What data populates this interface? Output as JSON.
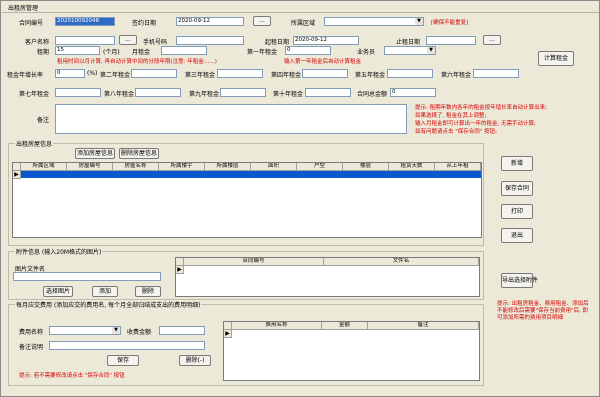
{
  "title": "出租房管理",
  "header": {
    "contract_no_label": "合同编号",
    "contract_no_value": "202010092048",
    "sign_date_label": "签约日期",
    "sign_date_value": "2020-09-12",
    "house_label": "所属区域",
    "note_dup": "[确保不能重复]",
    "tenant_label": "客户名称",
    "mobile_label": "手机号码",
    "start_label": "起租日期",
    "start_value": "2020-09-12",
    "end_label": "止租日期",
    "lease_label": "租期",
    "lease_value": "15",
    "lease_unit": "(个月)",
    "monthly_label": "月租金",
    "first_rent_label": "第一年租金",
    "first_rent_value": "0",
    "clerk_label": "业务员",
    "note_lease": "租用时间以月计算, 再自动计算中间的分段年限(注意: 年租金……)",
    "note_first": "输入第一年租金后自动计算租金",
    "calc_btn": "计算租金",
    "rent_growth_label": "租金年增长率",
    "rent_growth_value": "0",
    "pct": "(%)",
    "y2": "第二年租金",
    "y3": "第三年租金",
    "y4": "第四年租金",
    "y5": "第五年租金",
    "y6": "第六年租金",
    "y7": "第七年租金",
    "y8": "第八年租金",
    "y9": "第九年租金",
    "y10": "第十年租金",
    "total_label": "合同总金额",
    "total_value": "0",
    "remark_label": "备注",
    "tip1": "提示: 租期年数内各年的租金按年增长率自动计算出来;",
    "tip2": "    如果选择了, 租金在其上调整;",
    "tip3": "    输入月租金即可计算出一年的租金, 无需手动计算;",
    "tip4": "    如有问题请点击 \"保存合同\" 按钮。",
    "browse": "..."
  },
  "rooms": {
    "group_title": "出租房屋信息",
    "add_btn": "添加房屋信息",
    "del_btn": "删除房屋信息",
    "columns": [
      "所属区域",
      "房屋编号",
      "房屋名称",
      "所属楼宇",
      "所属楼层",
      "面积",
      "户型",
      "楼层",
      "租赁天数",
      "从上年租"
    ],
    "side_btns": [
      "新增",
      "保存合同",
      "打印",
      "退出"
    ]
  },
  "attach": {
    "group_title": "附件信息 (输入20M格式的图片)",
    "file_label": "图片文件名",
    "choose_btn": "选择图片",
    "add_btn": "添加",
    "delete_btn": "删除",
    "columns": [
      "合同编号",
      "文件名"
    ],
    "export_btn": "导出选择附件"
  },
  "fees": {
    "group_title": "每月应交费用 (添加应交的费用名, 每个月全部归结成支出的费用明细)",
    "fee_name_label": "费用名称",
    "amount_label": "收费金额",
    "fee_remark_label": "备注说明",
    "save_btn": "保存",
    "delete_btn": "删除(-)",
    "columns": [
      "费用名称",
      "金额",
      "备注"
    ],
    "tip": "提示: 若不需要修改请点击 \"保存合同\" 按钮",
    "side_tip": "提示: 出租房租金、费用租金、添加后不能修改后需要\"保存当前费用\"后, 即可添加所需的费用项目明细"
  }
}
